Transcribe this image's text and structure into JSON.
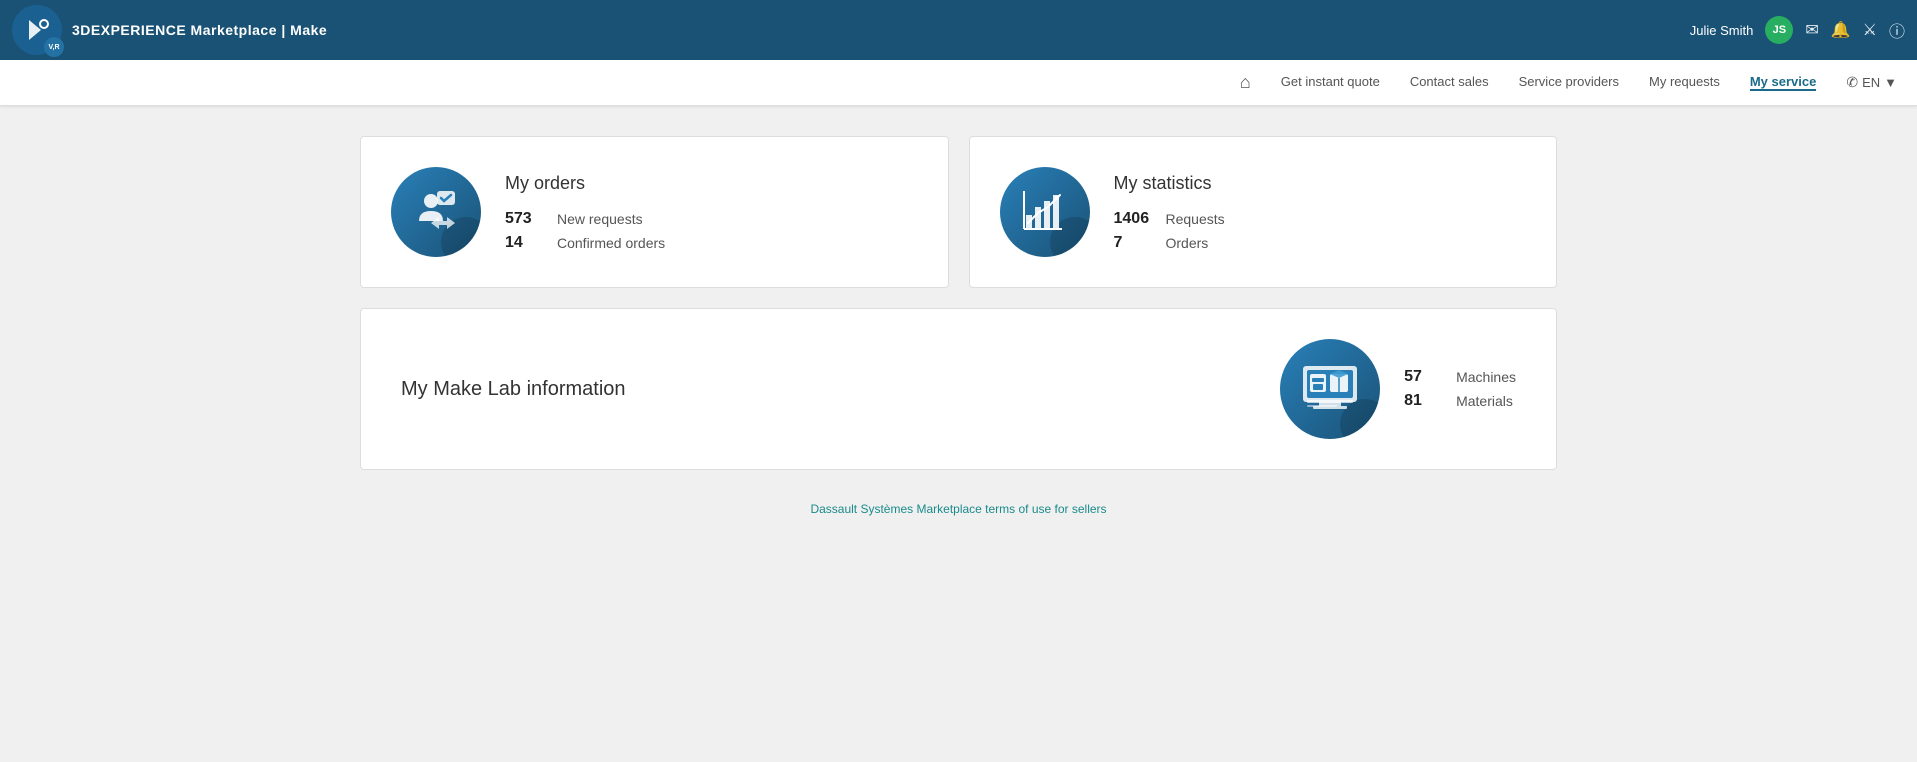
{
  "app": {
    "title_bold": "3D",
    "title_rest": "EXPERIENCE Marketplace | Make"
  },
  "header": {
    "logo_text": "3D",
    "logo_version": "V,R",
    "user_name": "Julie Smith",
    "user_initials": "JS",
    "icons": [
      "chat-icon",
      "bell-icon",
      "people-icon",
      "help-icon"
    ]
  },
  "nav": {
    "home_icon": "🏠",
    "items": [
      {
        "label": "Get instant quote",
        "active": false,
        "key": "get-instant-quote"
      },
      {
        "label": "Contact sales",
        "active": false,
        "key": "contact-sales"
      },
      {
        "label": "Service providers",
        "active": false,
        "key": "service-providers"
      },
      {
        "label": "My requests",
        "active": false,
        "key": "my-requests"
      },
      {
        "label": "My service",
        "active": true,
        "key": "my-service"
      }
    ],
    "lang_label": "EN",
    "lang_chevron": "▼"
  },
  "orders_card": {
    "title": "My orders",
    "stats": [
      {
        "number": "573",
        "label": "New requests"
      },
      {
        "number": "14",
        "label": "Confirmed orders"
      }
    ]
  },
  "statistics_card": {
    "title": "My statistics",
    "stats": [
      {
        "number": "1406",
        "label": "Requests"
      },
      {
        "number": "7",
        "label": "Orders"
      }
    ]
  },
  "makelab_card": {
    "title": "My Make Lab information",
    "stats": [
      {
        "number": "57",
        "label": "Machines"
      },
      {
        "number": "81",
        "label": "Materials"
      }
    ]
  },
  "footer": {
    "link_text": "Dassault Systèmes Marketplace terms of use for sellers",
    "link_href": "#"
  }
}
